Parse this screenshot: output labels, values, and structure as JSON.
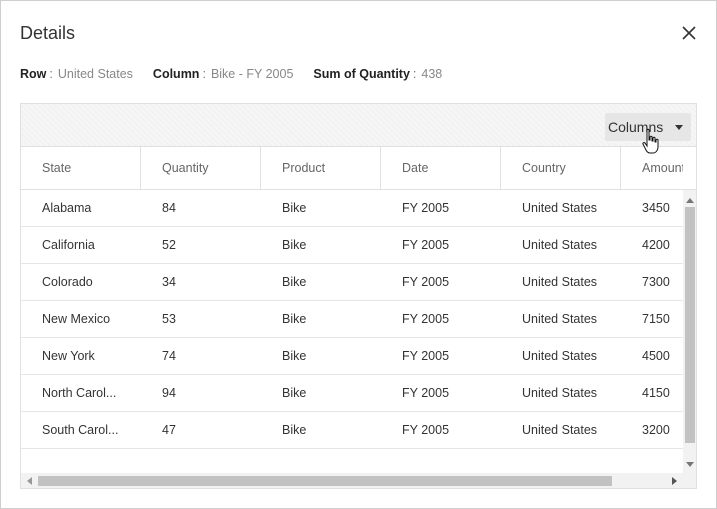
{
  "dialog": {
    "title": "Details",
    "close_icon": "close-icon"
  },
  "info": {
    "row_label": "Row",
    "row_value": "United States",
    "column_label": "Column",
    "column_value": "Bike - FY 2005",
    "sum_label": "Sum of Quantity",
    "sum_value": "438",
    "separator": ":"
  },
  "toolbar": {
    "columns_label": "Columns",
    "caret_icon": "caret-down-icon"
  },
  "grid": {
    "columns": [
      "State",
      "Quantity",
      "Product",
      "Date",
      "Country",
      "Amount"
    ],
    "rows": [
      [
        "Alabama",
        "84",
        "Bike",
        "FY 2005",
        "United States",
        "3450"
      ],
      [
        "California",
        "52",
        "Bike",
        "FY 2005",
        "United States",
        "4200"
      ],
      [
        "Colorado",
        "34",
        "Bike",
        "FY 2005",
        "United States",
        "7300"
      ],
      [
        "New Mexico",
        "53",
        "Bike",
        "FY 2005",
        "United States",
        "7150"
      ],
      [
        "New York",
        "74",
        "Bike",
        "FY 2005",
        "United States",
        "4500"
      ],
      [
        "North Carol...",
        "94",
        "Bike",
        "FY 2005",
        "United States",
        "4150"
      ],
      [
        "South Carol...",
        "47",
        "Bike",
        "FY 2005",
        "United States",
        "3200"
      ]
    ]
  }
}
